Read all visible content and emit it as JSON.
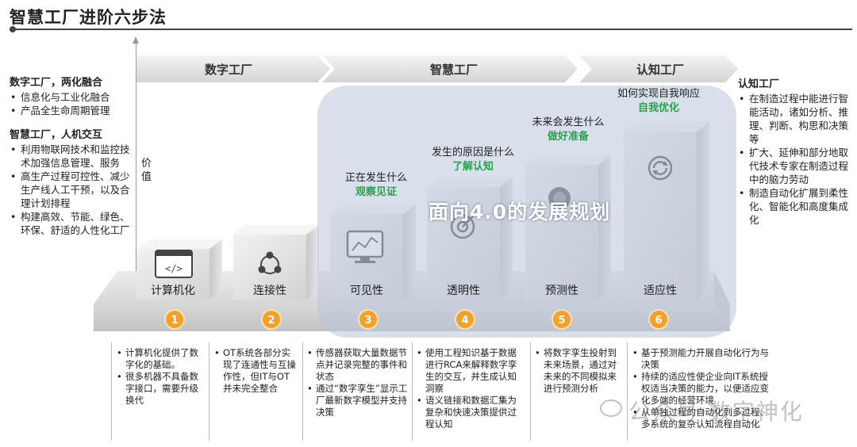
{
  "title": "智慧工厂进阶六步法",
  "value_label": "价值",
  "phases": [
    {
      "label": "数字工厂"
    },
    {
      "label": "智慧工厂"
    },
    {
      "label": "认知工厂"
    }
  ],
  "left": {
    "sections": [
      {
        "title": "数字工厂，两化融合",
        "items": [
          "信息化与工业化融合",
          "产品全生命周期管理"
        ]
      },
      {
        "title": "智慧工厂，人机交互",
        "items": [
          "利用物联网技术和监控技术加强信息管理、服务",
          "高生产过程可控性、减少生产线人工干预，以及合理计划排程",
          "构建高效、节能、绿色、环保、舒适的人性化工厂"
        ]
      }
    ]
  },
  "right": {
    "title": "认知工厂",
    "items": [
      "在制造过程中能进行智能活动，诸如分析、推理、判断、构思和决策等",
      "扩大、延伸和部分地取代技术专家在制造过程中的脑力劳动",
      "制造自动化扩展到柔性化、智能化和高度集成化"
    ]
  },
  "overlay_text": "面向4.0的发展规划",
  "steps": [
    {
      "num": "1",
      "label": "计算机化",
      "icon": "code-window-icon",
      "question": "",
      "answer": "",
      "desc": [
        "计算机化提供了数字化的基础。",
        "很多机器不具备数字接口，需要升级换代"
      ]
    },
    {
      "num": "2",
      "label": "连接性",
      "icon": "network-nodes-icon",
      "question": "",
      "answer": "",
      "desc": [
        "OT系统各部分实现了连通性与互操作性，但IT与OT并未完全整合"
      ]
    },
    {
      "num": "3",
      "label": "可见性",
      "icon": "monitor-chart-icon",
      "question": "正在发生什么",
      "answer": "观察见证",
      "desc": [
        "传感器获取大量数据节点并记录完整的事件和状态",
        "通过“数字孪生”显示工厂最新数字模型并支持决策"
      ]
    },
    {
      "num": "4",
      "label": "透明性",
      "icon": "target-icon",
      "question": "发生的原因是什么",
      "answer": "了解认知",
      "desc": [
        "使用工程知识基于数据进行RCA来解释数字孪生的交互，并生成认知洞察",
        "语义链接和数据汇集为复杂和快速决策提供过程认知"
      ]
    },
    {
      "num": "5",
      "label": "预测性",
      "icon": "forecast-icon",
      "question": "未来会发生什么",
      "answer": "做好准备",
      "desc": [
        "将数字孪生投射到未来场景，通过对未来的不同模拟来进行预测分析"
      ]
    },
    {
      "num": "6",
      "label": "适应性",
      "icon": "cycle-arrows-icon",
      "question": "如何实现自我响应",
      "answer": "自我优化",
      "desc": [
        "基于预测能力开展自动化行为与决策",
        "持续的适应性使企业向IT系统授权适当决策的能力，以便适应变化多端的经营环境",
        "从单独过程的自动化到多过程、多系统的复杂认知流程自动化"
      ]
    }
  ],
  "watermark": "公众号·数字神化",
  "colors": {
    "accent_green": "#2e9e4f",
    "badge_orange": "#f2a12d",
    "overlay": "#bac7dc"
  }
}
